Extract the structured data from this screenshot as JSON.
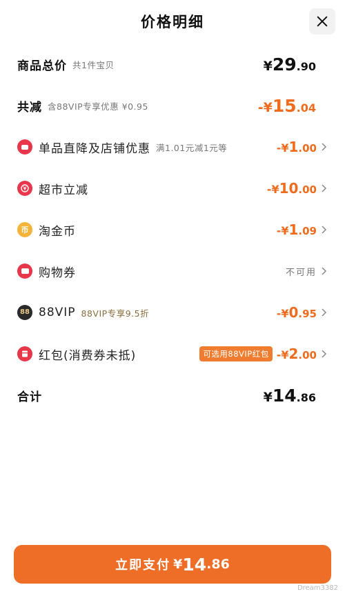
{
  "header": {
    "title": "价格明细"
  },
  "summary": {
    "total": {
      "label": "商品总价",
      "sub": "共1件宝贝",
      "yen": "¥",
      "int": "29",
      "dec": ".90"
    },
    "reduction": {
      "label": "共减",
      "sub": "含88VIP专享优惠 ¥0.95",
      "yen": "-¥",
      "int": "15",
      "dec": ".04"
    }
  },
  "items": [
    {
      "label": "单品直降及店铺优惠",
      "sub": "满1.01元减1元等",
      "yen": "-¥",
      "int": "1",
      "dec": ".00",
      "icon": "shop-discount-icon"
    },
    {
      "label": "超市立减",
      "sub": "",
      "yen": "-¥",
      "int": "10",
      "dec": ".00",
      "icon": "yen-circle-icon"
    },
    {
      "label": "淘金币",
      "sub": "",
      "yen": "-¥",
      "int": "1",
      "dec": ".09",
      "icon": "coin-icon"
    },
    {
      "label": "购物券",
      "sub": "",
      "status": "不可用",
      "icon": "coupon-icon"
    },
    {
      "label": "88VIP",
      "sub": "88VIP专享9.5折",
      "yen": "-¥",
      "int": "0",
      "dec": ".95",
      "icon": "vip-88-icon"
    },
    {
      "label": "红包(消费券未抵)",
      "tag": "可选用88VIP红包",
      "yen": "-¥",
      "int": "2",
      "dec": ".00",
      "icon": "red-packet-icon"
    }
  ],
  "total_row": {
    "label": "合计",
    "yen": "¥",
    "int": "14",
    "dec": ".86"
  },
  "pay_button": {
    "label": "立即支付",
    "yen": "¥",
    "int": "14",
    "dec": ".86"
  },
  "icon_text": {
    "coin": "币",
    "vip": "88"
  },
  "watermark": "Dream3382",
  "colors": {
    "accent": "#ef6b1d",
    "button": "#ee6e28",
    "icon_red": "#e8364a",
    "icon_gold": "#f3b43a"
  }
}
